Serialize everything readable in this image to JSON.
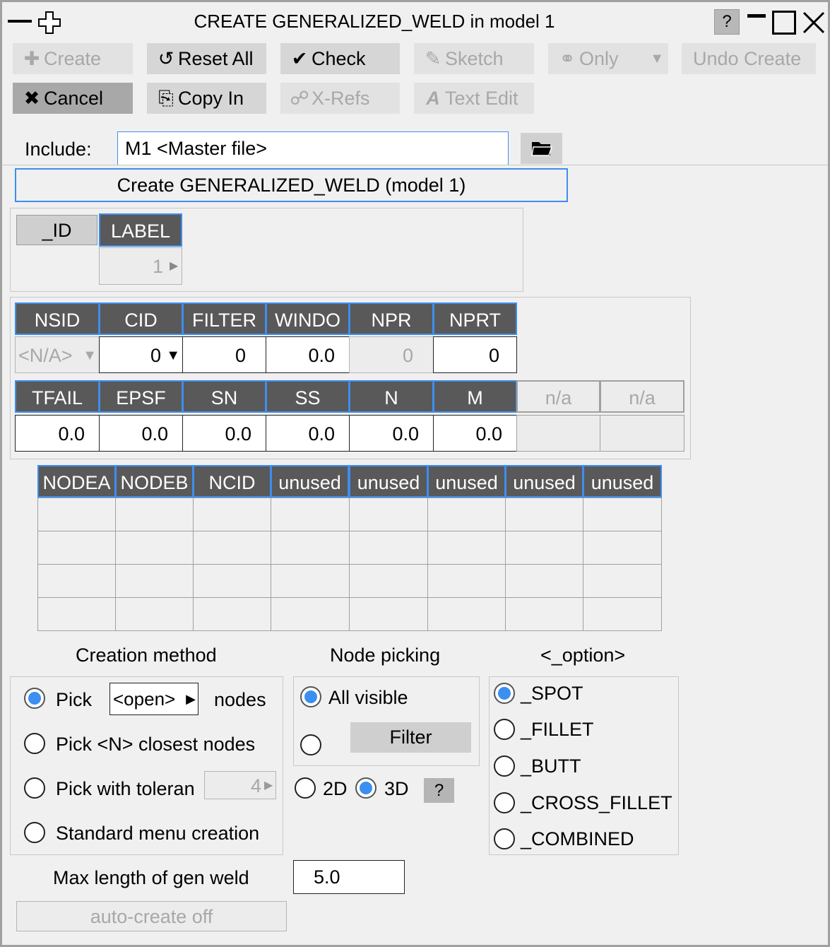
{
  "window": {
    "title": "CREATE GENERALIZED_WELD in model 1",
    "help_label": "?"
  },
  "toolbar": {
    "create": "Create",
    "reset_all": "Reset All",
    "check": "Check",
    "sketch": "Sketch",
    "only": "Only",
    "undo_create": "Undo Create",
    "cancel": "Cancel",
    "copy_in": "Copy In",
    "xrefs": "X-Refs",
    "text_edit": "Text Edit"
  },
  "include": {
    "label": "Include:",
    "value": "M1  <Master file>"
  },
  "banner": "Create GENERALIZED_WELD (model 1)",
  "id_block": {
    "id_tab": "_ID",
    "label_tab": "LABEL",
    "label_value": "1"
  },
  "row1": {
    "headers": [
      "NSID",
      "CID",
      "FILTER",
      "WINDO",
      "NPR",
      "NPRT"
    ],
    "values": [
      "<N/A>",
      "0",
      "0",
      "0.0",
      "0",
      "0"
    ]
  },
  "row2": {
    "headers": [
      "TFAIL",
      "EPSF",
      "SN",
      "SS",
      "N",
      "M",
      "n/a",
      "n/a"
    ],
    "values": [
      "0.0",
      "0.0",
      "0.0",
      "0.0",
      "0.0",
      "0.0",
      "",
      ""
    ]
  },
  "node_table": {
    "headers": [
      "NODEA",
      "NODEB",
      "NCID",
      "unused",
      "unused",
      "unused",
      "unused",
      "unused"
    ]
  },
  "creation_method": {
    "title": "Creation method",
    "pick": "Pick",
    "pick_value": "<open>",
    "nodes": "nodes",
    "pick_n": "Pick <N> closest nodes",
    "pick_tol": "Pick with toleran",
    "tol_value": "4",
    "standard": "Standard menu creation"
  },
  "node_picking": {
    "title": "Node picking",
    "all_visible": "All visible",
    "filter": "Filter",
    "mode_2d": "2D",
    "mode_3d": "3D",
    "help": "?"
  },
  "option": {
    "title": "<_option>",
    "items": [
      "_SPOT",
      "_FILLET",
      "_BUTT",
      "_CROSS_FILLET",
      "_COMBINED"
    ]
  },
  "max_length": {
    "label": "Max length of gen weld",
    "value": "5.0"
  },
  "auto_create": "auto-create off"
}
